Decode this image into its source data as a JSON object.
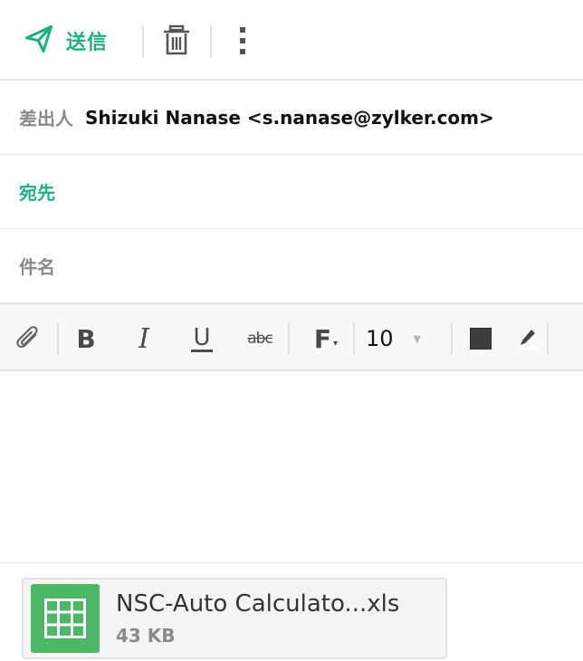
{
  "toolbar": {
    "send_label": "送信",
    "send_icon": "paper-plane-icon",
    "delete_icon": "trash-icon",
    "more_icon": "vertical-ellipsis-icon"
  },
  "header": {
    "from_label": "差出人",
    "from_value": "Shizuki Nanase <s.nanase@zylker.com>",
    "to_label": "宛先",
    "subject_label": "件名"
  },
  "format_toolbar": {
    "attach_icon": "paperclip-icon",
    "bold": "B",
    "italic": "I",
    "underline": "U",
    "strikethrough": "abc",
    "font": "F",
    "font_caret": "▾",
    "font_size": "10",
    "font_size_caret": "▼",
    "text_color": "#3d3d3d",
    "highlight_icon": "highlighter-pen-icon"
  },
  "attachment": {
    "name": "NSC-Auto Calculato...xls",
    "size": "43 KB",
    "icon": "spreadsheet-icon"
  },
  "colors": {
    "accent": "#1eb07f",
    "spreadsheet": "#4cb865"
  }
}
